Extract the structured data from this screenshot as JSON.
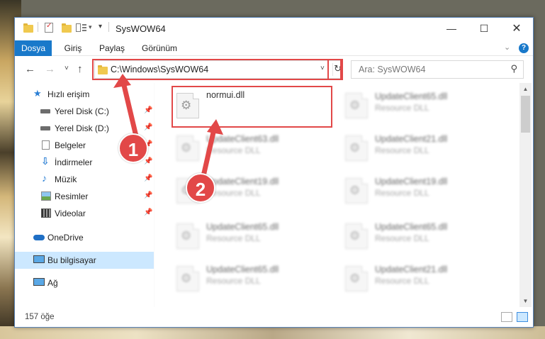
{
  "window": {
    "title": "SysWOW64"
  },
  "ribbon": {
    "tabs": [
      {
        "label": "Dosya",
        "active": true
      },
      {
        "label": "Giriş"
      },
      {
        "label": "Paylaş"
      },
      {
        "label": "Görünüm"
      }
    ],
    "help": "?"
  },
  "navigation": {
    "address": "C:\\Windows\\SysWOW64",
    "search_placeholder": "Ara: SysWOW64"
  },
  "sidebar": {
    "items": [
      {
        "label": "Hızlı erişim",
        "icon": "star-icon"
      },
      {
        "label": "Yerel Disk (C:)",
        "icon": "drive-icon",
        "pinned": true
      },
      {
        "label": "Yerel Disk (D:)",
        "icon": "drive-icon",
        "pinned": true
      },
      {
        "label": "Belgeler",
        "icon": "documents-icon",
        "pinned": true
      },
      {
        "label": "İndirmeler",
        "icon": "downloads-icon",
        "pinned": true
      },
      {
        "label": "Müzik",
        "icon": "music-icon",
        "pinned": true
      },
      {
        "label": "Resimler",
        "icon": "pictures-icon",
        "pinned": true
      },
      {
        "label": "Videolar",
        "icon": "videos-icon",
        "pinned": true
      },
      {
        "label": "OneDrive",
        "icon": "onedrive-icon"
      },
      {
        "label": "Bu bilgisayar",
        "icon": "computer-icon",
        "selected": true
      },
      {
        "label": "Ağ",
        "icon": "network-icon"
      }
    ]
  },
  "files": [
    {
      "name": "normui.dll",
      "desc": ""
    },
    {
      "name": "UpdateClient65.dll",
      "desc": "Resource DLL"
    },
    {
      "name": "UpdateClient63.dll",
      "desc": "Resource DLL"
    },
    {
      "name": "UpdateClient21.dll",
      "desc": "Resource DLL"
    },
    {
      "name": "UpdateClient19.dll",
      "desc": "Resource DLL"
    },
    {
      "name": "UpdateClient19.dll",
      "desc": "Resource DLL"
    },
    {
      "name": "UpdateClient65.dll",
      "desc": "Resource DLL"
    },
    {
      "name": "UpdateClient65.dll",
      "desc": "Resource DLL"
    },
    {
      "name": "UpdateClient65.dll",
      "desc": "Resource DLL"
    },
    {
      "name": "UpdateClient21.dll",
      "desc": "Resource DLL"
    }
  ],
  "status": {
    "count": "157 öğe"
  },
  "annotations": {
    "step1": "1",
    "step2": "2",
    "color": "#e24848"
  }
}
